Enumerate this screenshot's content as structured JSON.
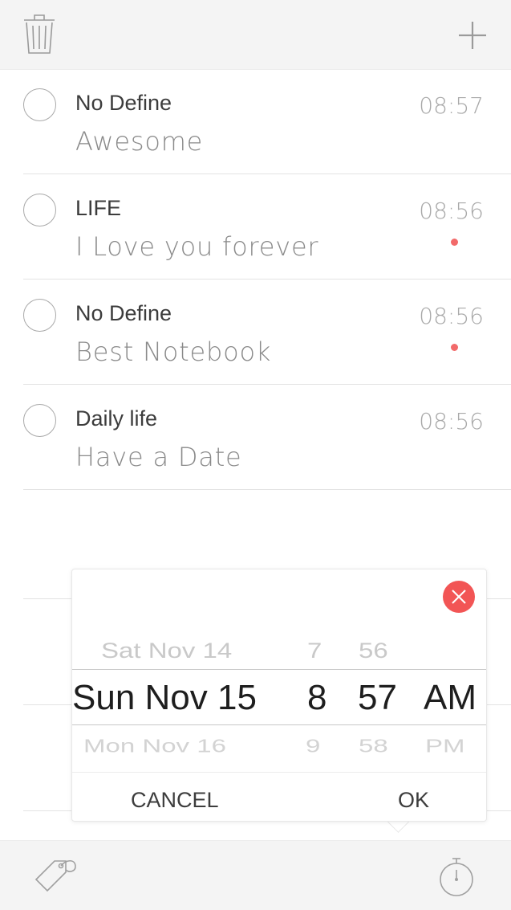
{
  "toolbar": {
    "trash_icon": "trash-icon",
    "add_icon": "plus-icon"
  },
  "tasks": [
    {
      "category": "No Define",
      "title": "Awesome",
      "time": "08:57",
      "has_dot": false
    },
    {
      "category": "LIFE",
      "title": "I Love you forever",
      "time": "08:56",
      "has_dot": true
    },
    {
      "category": "No Define",
      "title": "Best Notebook",
      "time": "08:56",
      "has_dot": true
    },
    {
      "category": "Daily life",
      "title": "Have a Date",
      "time": "08:56",
      "has_dot": false
    }
  ],
  "picker": {
    "date_prev": "Sat Nov 14",
    "date_selected": "Sun Nov 15",
    "date_next": "Mon Nov 16",
    "hour_prev": "7",
    "hour_selected": "8",
    "hour_next": "9",
    "minute_prev": "56",
    "minute_selected": "57",
    "minute_next": "58",
    "ampm_selected": "AM",
    "ampm_next": "PM",
    "cancel_label": "CANCEL",
    "ok_label": "OK"
  },
  "colors": {
    "accent_red": "#f25555",
    "dot_red": "#f26a6a"
  },
  "bottombar": {
    "tag_icon": "tag-icon",
    "timer_icon": "stopwatch-icon"
  }
}
